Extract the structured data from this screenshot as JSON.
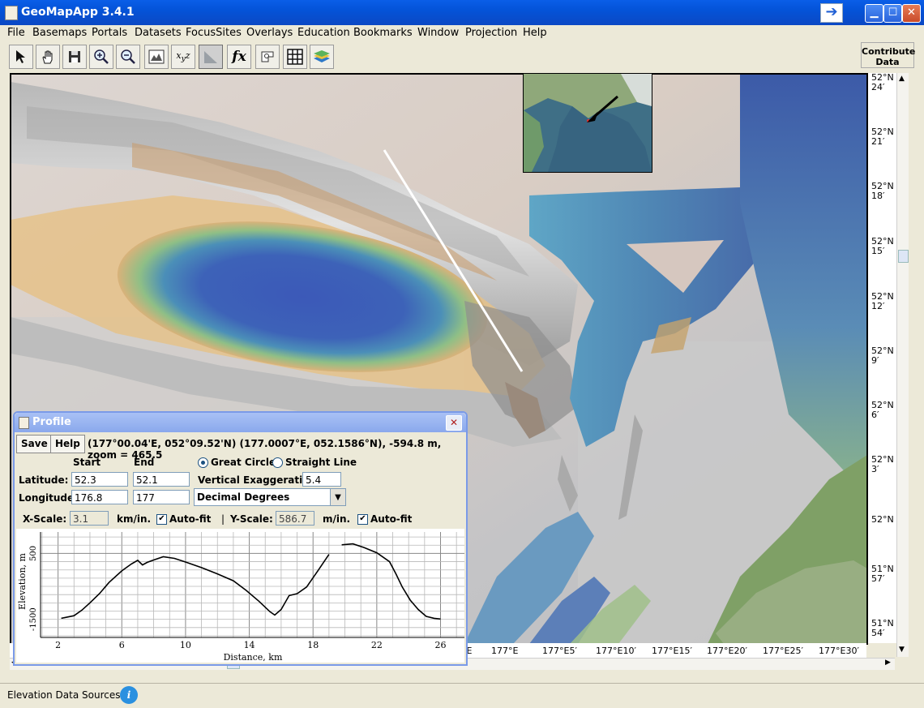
{
  "window": {
    "title": "GeoMapApp 3.4.1"
  },
  "menu": [
    "File",
    "Basemaps",
    "Portals",
    "Datasets",
    "FocusSites",
    "Overlays",
    "Education",
    "Bookmarks",
    "Window",
    "Projection",
    "Help"
  ],
  "toolbar": {
    "tools": [
      "select-arrow-icon",
      "pan-hand-icon",
      "save-icon",
      "zoom-in-icon",
      "zoom-out-icon",
      "image-icon",
      "xyz-icon",
      "profile-icon",
      "fx-icon",
      "digitize-icon",
      "grid-icon",
      "layers-icon"
    ],
    "contribute_line1": "Contribute",
    "contribute_line2": "Data"
  },
  "map": {
    "lat_labels": [
      {
        "deg": "52°N",
        "min": "24′"
      },
      {
        "deg": "52°N",
        "min": "21′"
      },
      {
        "deg": "52°N",
        "min": "18′"
      },
      {
        "deg": "52°N",
        "min": "15′"
      },
      {
        "deg": "52°N",
        "min": "12′"
      },
      {
        "deg": "52°N",
        "min": "9′"
      },
      {
        "deg": "52°N",
        "min": "6′"
      },
      {
        "deg": "52°N",
        "min": "3′"
      },
      {
        "deg": "52°N",
        "min": ""
      },
      {
        "deg": "51°N",
        "min": "57′"
      },
      {
        "deg": "51°N",
        "min": "54′"
      }
    ],
    "lon_labels": [
      "′E",
      "177°E",
      "177°E5′",
      "177°E10′",
      "177°E15′",
      "177°E20′",
      "177°E25′",
      "177°E30′"
    ]
  },
  "status": {
    "label": "Elevation Data Sources",
    "info_icon": "i"
  },
  "profile": {
    "title": "Profile",
    "save_label": "Save",
    "help_label": "Help",
    "readout": "(177°00.04'E,  052°09.52'N) (177.0007°E,  052.1586°N),  -594.8 m,  zoom = 465.5",
    "start_header": "Start",
    "end_header": "End",
    "latitude_label": "Latitude:",
    "longitude_label": "Longitude:",
    "lat_start": "52.3",
    "lat_end": "52.1",
    "lon_start": "176.8",
    "lon_end": "177",
    "great_circle_label": "Great Circle",
    "straight_line_label": "Straight Line",
    "path_mode": "Great Circle",
    "vert_exag_label": "Vertical Exaggeration:",
    "vert_exag_value": "5.4",
    "units_select": "Decimal Degrees",
    "xscale_label": "X-Scale:",
    "xscale_value": "3.1",
    "xscale_units": "km/in.",
    "autofit_label": "Auto-fit",
    "separator": "|",
    "yscale_label": "Y-Scale:",
    "yscale_value": "586.7",
    "yscale_units": "m/in.",
    "check_mark": "✔",
    "dropdown_arrow": "▼"
  },
  "chart_data": {
    "type": "line",
    "title": "",
    "xlabel": "Distance, km",
    "ylabel": "Elevation, m",
    "x_ticks": [
      2,
      6,
      10,
      14,
      18,
      22,
      26
    ],
    "y_ticks": [
      500,
      -1500
    ],
    "xlim": [
      0.9,
      27.5
    ],
    "ylim": [
      -2050,
      1150
    ],
    "grid": true,
    "series": [
      {
        "segments": [
          [
            [
              2.2,
              -1470
            ],
            [
              3.0,
              -1390
            ],
            [
              3.5,
              -1220
            ],
            [
              4.0,
              -1000
            ],
            [
              4.6,
              -720
            ],
            [
              5.2,
              -380
            ],
            [
              6.0,
              -30
            ],
            [
              6.6,
              180
            ],
            [
              7.0,
              290
            ],
            [
              7.3,
              150
            ],
            [
              7.6,
              230
            ],
            [
              8.0,
              300
            ],
            [
              8.6,
              400
            ],
            [
              9.3,
              350
            ],
            [
              10.0,
              240
            ],
            [
              11.0,
              70
            ],
            [
              12.0,
              -120
            ],
            [
              13.0,
              -330
            ],
            [
              13.8,
              -620
            ],
            [
              14.6,
              -950
            ],
            [
              15.3,
              -1270
            ],
            [
              15.6,
              -1370
            ],
            [
              16.0,
              -1200
            ],
            [
              16.5,
              -780
            ],
            [
              17.0,
              -720
            ],
            [
              17.6,
              -520
            ],
            [
              18.3,
              -30
            ],
            [
              19.0,
              470
            ]
          ],
          [
            [
              19.8,
              760
            ],
            [
              20.5,
              790
            ],
            [
              21.2,
              680
            ],
            [
              22.0,
              520
            ],
            [
              22.8,
              250
            ],
            [
              23.2,
              -120
            ],
            [
              23.6,
              -520
            ],
            [
              24.1,
              -920
            ],
            [
              24.6,
              -1200
            ],
            [
              25.1,
              -1410
            ],
            [
              25.6,
              -1470
            ],
            [
              26.0,
              -1490
            ]
          ]
        ]
      }
    ]
  }
}
